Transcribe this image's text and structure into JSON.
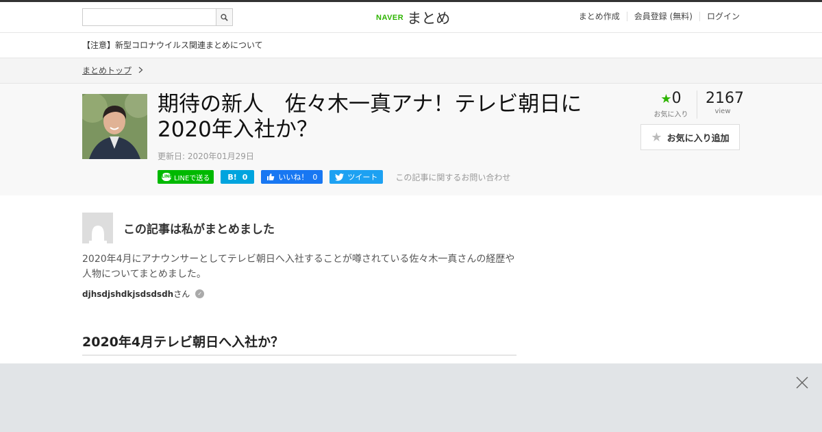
{
  "header": {
    "search_placeholder": "",
    "logo_naver": "NAVER",
    "logo_matome": "まとめ",
    "nav": [
      "まとめ作成",
      "会員登録 (無料)",
      "ログイン"
    ]
  },
  "notice": "【注意】新型コロナウイルス関連まとめについて",
  "breadcrumb": "まとめトップ",
  "article": {
    "title": "期待の新人　佐々木一真アナ！テレビ朝日に2020年入社か？",
    "updated": "更新日: 2020年01月29日",
    "shares": {
      "line": "LINEで送る",
      "hatena_label": "B!",
      "hatena_count": "0",
      "fb_label": "いいね！",
      "fb_count": "0",
      "tweet": "ツイート"
    },
    "contact": "この記事に関するお問い合わせ",
    "fav_count": "0",
    "fav_label": "お気に入り",
    "views": "2167",
    "views_label": "view",
    "fav_button": "お気に入り追加"
  },
  "author": {
    "heading": "この記事は私がまとめました",
    "description": "2020年4月にアナウンサーとしてテレビ朝日へ入社することが噂されている佐々木一真さんの経歴や人物についてまとめました。",
    "username": "djhsdjshdkjsdsdsdh",
    "suffix": "さん"
  },
  "section_heading": "2020年4月テレビ朝日へ入社か？",
  "colors": {
    "brand": "#2db400",
    "line": "#00b900",
    "hatena": "#00a4de",
    "facebook": "#1877f2",
    "twitter": "#1da1f2"
  }
}
